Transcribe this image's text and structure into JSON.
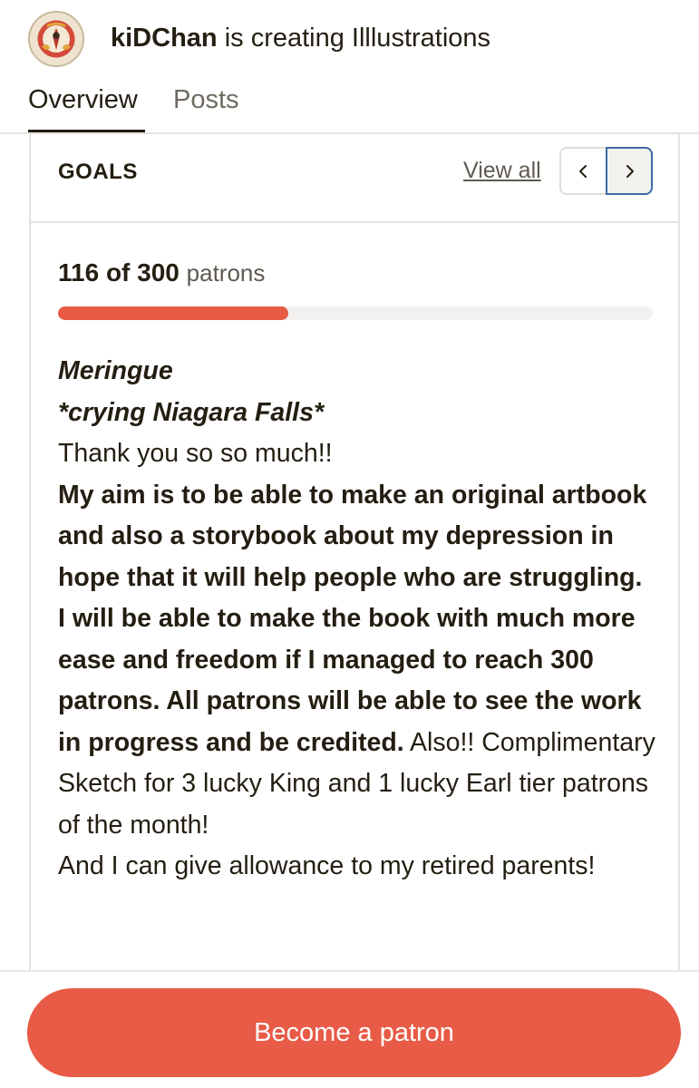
{
  "header": {
    "creator_name": "kiDChan",
    "creating_text": " is creating Illlustrations",
    "avatar_icon": "creator-avatar"
  },
  "tabs": [
    {
      "label": "Overview",
      "active": true
    },
    {
      "label": "Posts",
      "active": false
    }
  ],
  "goals": {
    "section_title": "GOALS",
    "view_all_label": "View all",
    "prev_icon": "chevron-left-icon",
    "next_icon": "chevron-right-icon",
    "progress_count": "116 of 300",
    "progress_unit": "patrons",
    "progress_current": 116,
    "progress_target": 300,
    "goal_title": "Meringue",
    "goal_subtitle": "*crying Niagara Falls*",
    "thanks": "Thank you so so much!!",
    "aim_bold": "My aim is to be able to make an original artbook and also a storybook about my depression in hope that it will help people who are struggling. I will be able to make the book with much more ease and freedom if I managed to reach 300 patrons. All patrons will be able to see the work in progress and be credited.",
    "aim_regular": " Also!! Complimentary Sketch for 3 lucky King and 1 lucky Earl tier patrons of the month!",
    "parents": "And I can give allowance to my retired parents!"
  },
  "cta": {
    "label": "Become a patron"
  },
  "colors": {
    "accent": "#e85b46",
    "text": "#241e12",
    "muted": "#5f5a50",
    "border": "#e5e3dd",
    "focus": "#3b6aa8"
  }
}
